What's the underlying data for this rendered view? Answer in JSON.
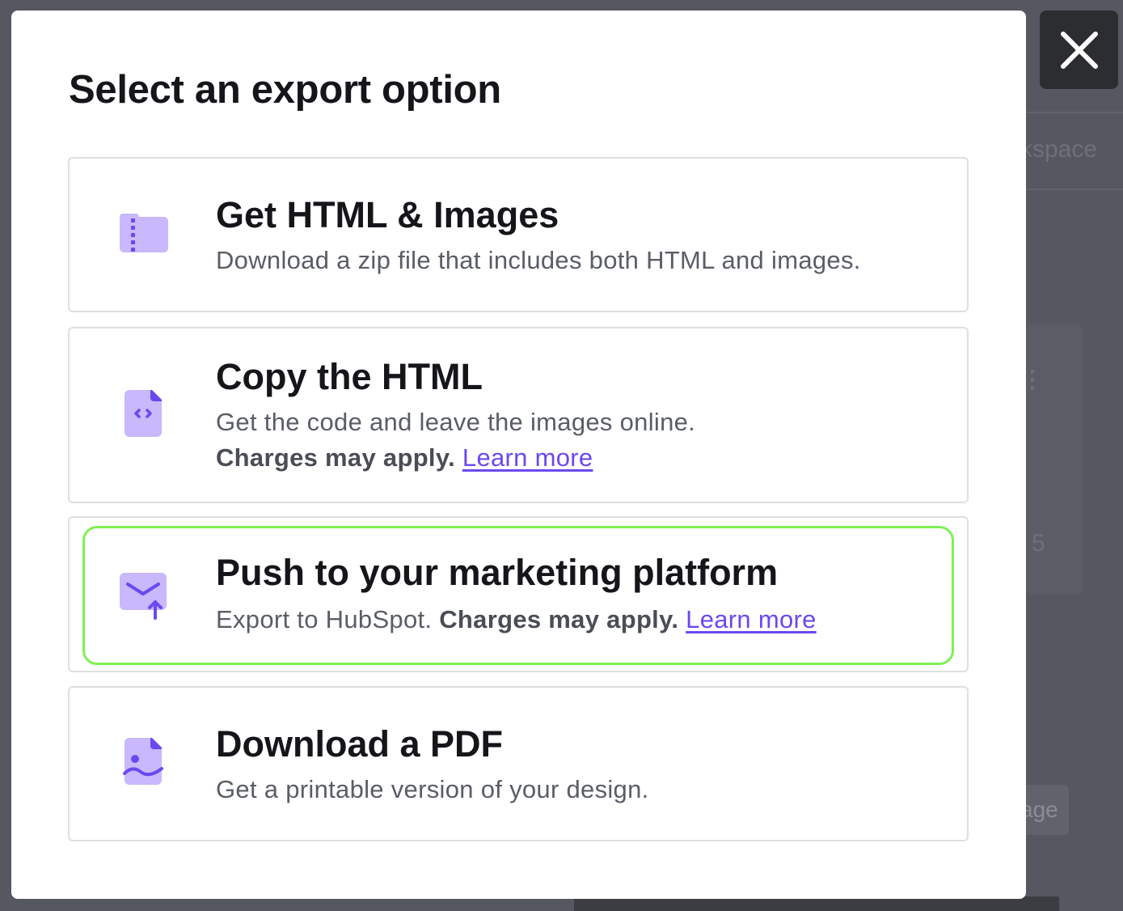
{
  "background": {
    "workspace_partial": "kspace",
    "badge_partial": "5",
    "button_partial": "age"
  },
  "modal": {
    "title": "Select an export option",
    "close_icon": "close-icon",
    "options": [
      {
        "id": "html-images",
        "icon": "zip-folder-icon",
        "title": "Get HTML & Images",
        "description": "Download a zip file that includes both HTML and images."
      },
      {
        "id": "copy-html",
        "icon": "code-file-icon",
        "title": "Copy the HTML",
        "description": "Get the code and leave the images online.",
        "charges": "Charges may apply.",
        "learn_more": "Learn more"
      },
      {
        "id": "marketing-platform",
        "icon": "mail-upload-icon",
        "title": "Push to your marketing platform",
        "description": "Export to HubSpot.",
        "charges": "Charges may apply.",
        "learn_more": "Learn more",
        "focused": true
      },
      {
        "id": "pdf",
        "icon": "image-file-icon",
        "title": "Download a PDF",
        "description": "Get a printable version of your design."
      }
    ]
  },
  "colors": {
    "accent": "#6b48f0",
    "icon_fill": "#c9b8fb",
    "focus_ring": "#7ef152",
    "overlay": "#555861"
  }
}
